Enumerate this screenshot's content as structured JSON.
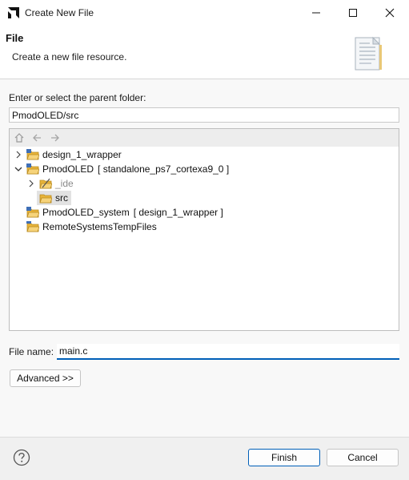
{
  "window": {
    "title": "Create New File"
  },
  "header": {
    "title": "File",
    "description": "Create a new file resource."
  },
  "form": {
    "parent_label": "Enter or select the parent folder:",
    "parent_value": "PmodOLED/src",
    "filename_label": "File name:",
    "filename_value": "main.c",
    "advanced_label": "Advanced >>"
  },
  "tree": {
    "items": [
      {
        "label": "design_1_wrapper",
        "detail": "",
        "expanded": false
      },
      {
        "label": "PmodOLED",
        "detail": "[ standalone_ps7_cortexa9_0 ]",
        "expanded": true
      },
      {
        "label": "_ide",
        "detail": "",
        "expanded": false
      },
      {
        "label": "src",
        "detail": "",
        "selected": true
      },
      {
        "label": "PmodOLED_system",
        "detail": "[ design_1_wrapper ]"
      },
      {
        "label": "RemoteSystemsTempFiles",
        "detail": ""
      }
    ]
  },
  "footer": {
    "finish_label": "Finish",
    "cancel_label": "Cancel"
  },
  "colors": {
    "accent": "#005fb8",
    "folder": "#e8b43a",
    "project_blue": "#3f6fb6"
  },
  "icons": {
    "app": "amd-logo-icon",
    "minimize": "minimize-icon",
    "maximize": "maximize-icon",
    "close": "close-icon",
    "header": "file-page-icon",
    "home": "home-icon",
    "back": "back-arrow-icon",
    "forward": "forward-arrow-icon",
    "help": "help-icon"
  }
}
